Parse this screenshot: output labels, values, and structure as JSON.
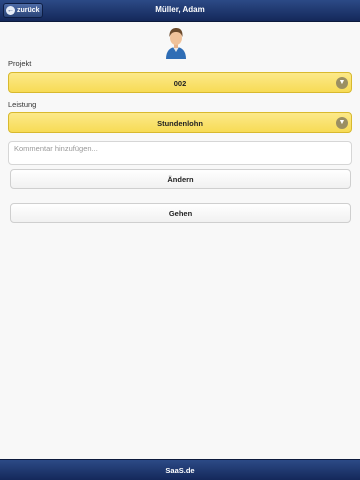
{
  "header": {
    "back_label": "zurück",
    "back_icon": "arrow-left-icon",
    "title": "Müller, Adam"
  },
  "avatar": {
    "icon": "user-avatar-icon"
  },
  "form": {
    "project_label": "Projekt",
    "project_value": "002",
    "service_label": "Leistung",
    "service_value": "Stundenlohn",
    "comment_placeholder": "Kommentar hinzufügen...",
    "comment_value": ""
  },
  "buttons": {
    "change_label": "Ändern",
    "go_label": "Gehen"
  },
  "footer": {
    "text": "SaaS.de"
  },
  "colors": {
    "header_bg": "#1f3a73",
    "select_bg": "#f9df64",
    "chevron_bg": "#9b8f62",
    "page_bg": "#f8f8f8"
  }
}
